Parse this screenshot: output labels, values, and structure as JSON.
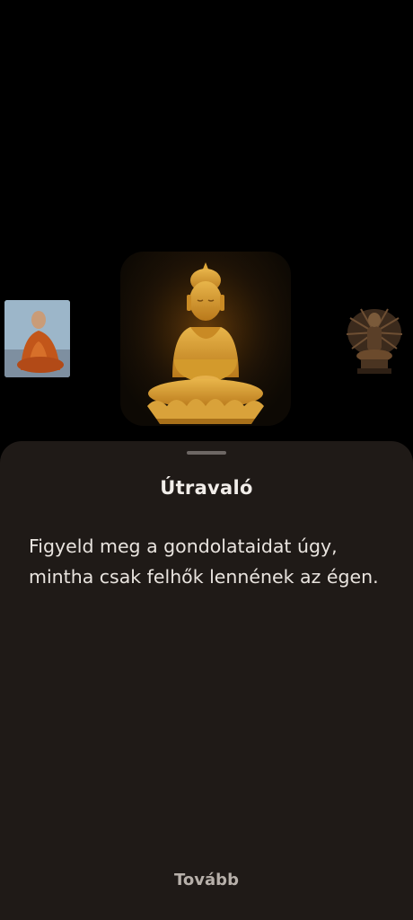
{
  "carousel": {
    "items": [
      {
        "name": "monk-portrait-image",
        "selected": false
      },
      {
        "name": "golden-buddha-image",
        "selected": true
      },
      {
        "name": "thousand-armed-statue-image",
        "selected": false
      }
    ]
  },
  "sheet": {
    "title": "Útravaló",
    "quote": "Figyeld meg a gondolataidat úgy, mintha csak felhők lennének az égen.",
    "next_label": "Tovább"
  },
  "colors": {
    "sheet_background": "#1f1a17",
    "gold": "#d39a2c",
    "text": "#e9e4df",
    "muted_text": "#b7b0aa"
  }
}
